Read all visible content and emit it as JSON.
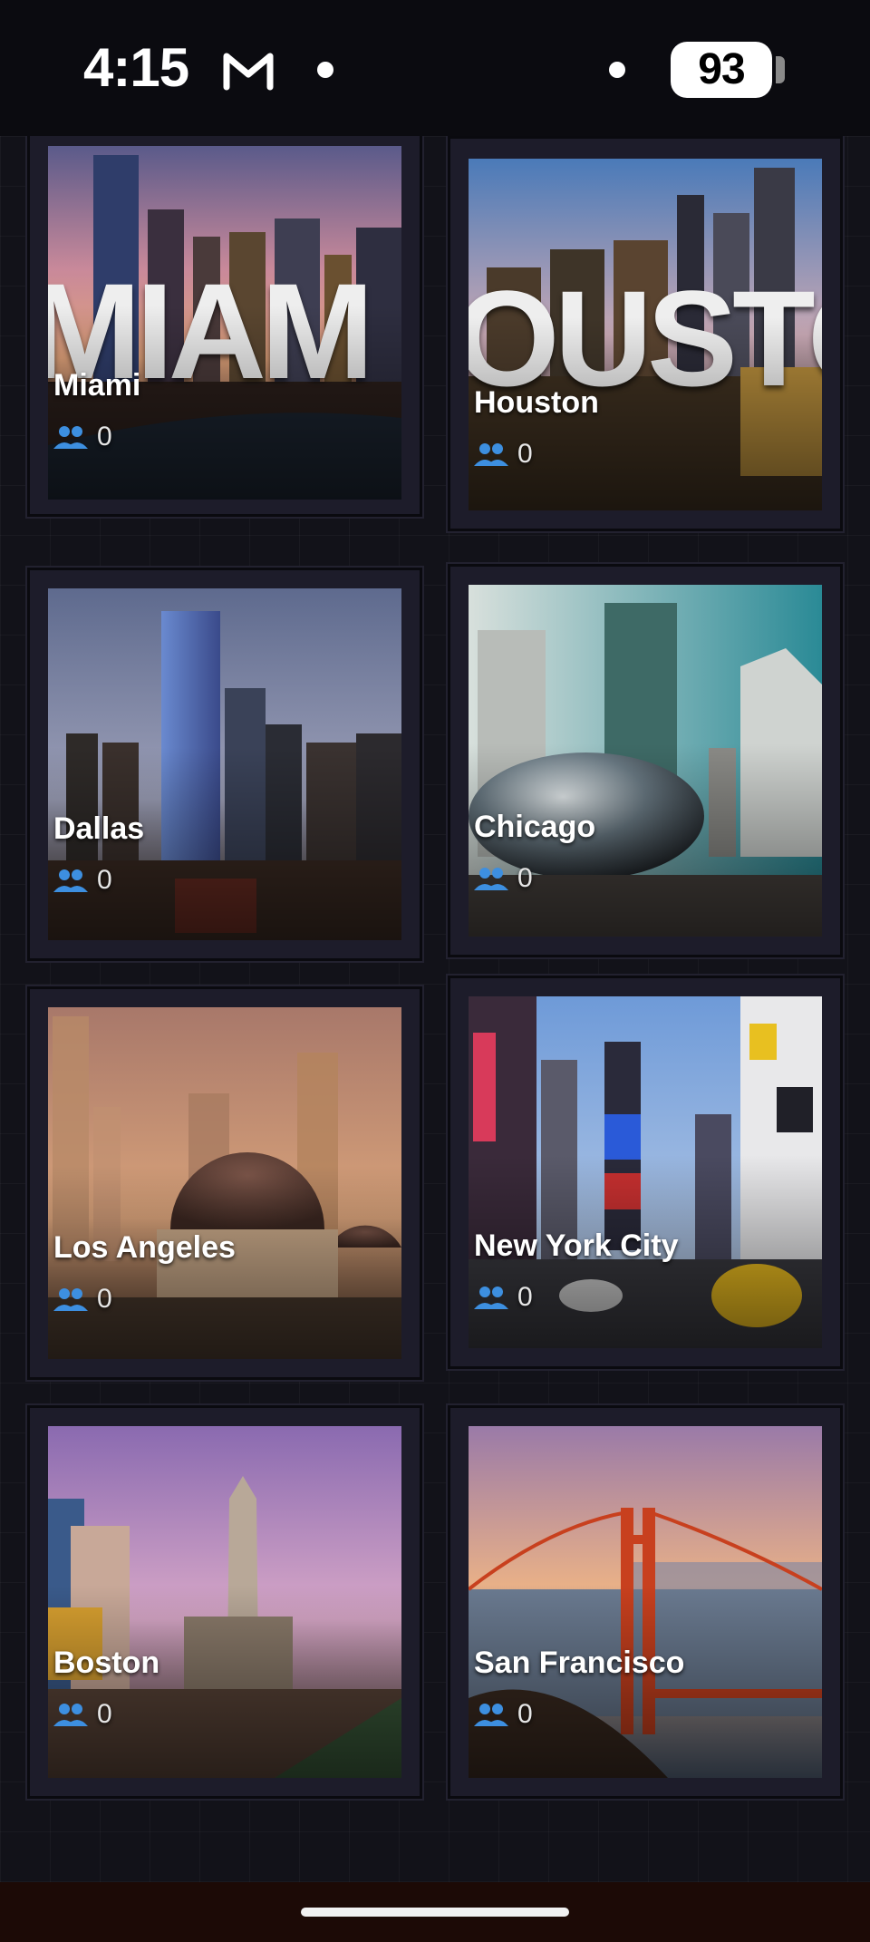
{
  "status_bar": {
    "time": "4:15",
    "battery_level": "93"
  },
  "cities": [
    {
      "name": "Miami",
      "count": "0",
      "banner_text": "MIAM"
    },
    {
      "name": "Houston",
      "count": "0",
      "banner_text": "OUSTO"
    },
    {
      "name": "Dallas",
      "count": "0"
    },
    {
      "name": "Chicago",
      "count": "0"
    },
    {
      "name": "Los Angeles",
      "count": "0"
    },
    {
      "name": "New York City",
      "count": "0"
    },
    {
      "name": "Boston",
      "count": "0"
    },
    {
      "name": "San Francisco",
      "count": "0"
    }
  ],
  "icons": {
    "mail": "gmail-icon",
    "members": "people-icon"
  },
  "colors": {
    "background": "#121219",
    "card": "#1d1c2a",
    "member_icon": "#3d8fe0"
  }
}
